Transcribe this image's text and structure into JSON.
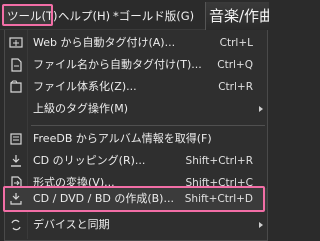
{
  "menubar": {
    "tools_label": "ツール(T)",
    "help_label": "ヘルプ(H)",
    "gold_label": "*ゴールド版(G)",
    "right_title": "音楽/作曲"
  },
  "menu": {
    "items": [
      {
        "label": "Web から自動タグ付け(A)...",
        "shortcut": "Ctrl+L",
        "icon": "web-tag-icon"
      },
      {
        "label": "ファイル名から自動タグ付け(T)...",
        "shortcut": "Ctrl+Q",
        "icon": "file-tag-icon"
      },
      {
        "label": "ファイル体系化(Z)...",
        "shortcut": "Ctrl+R",
        "icon": "organize-icon"
      },
      {
        "label": "上級のタグ操作(M)",
        "shortcut": "",
        "icon": "",
        "submenu": true
      },
      {
        "label": "FreeDB からアルバム情報を取得(F)",
        "shortcut": "",
        "icon": "freedb-icon"
      },
      {
        "label": "CD のリッピング(R)...",
        "shortcut": "Shift+Ctrl+R",
        "icon": "rip-cd-icon"
      },
      {
        "label": "形式の変換(V)...",
        "shortcut": "Shift+Ctrl+C",
        "icon": "convert-icon"
      },
      {
        "label": "CD / DVD / BD の作成(B)...",
        "shortcut": "Shift+Ctrl+D",
        "icon": "burn-disc-icon"
      },
      {
        "label": "デバイスと同期",
        "shortcut": "",
        "icon": "sync-icon",
        "submenu": true
      }
    ]
  },
  "colors": {
    "accent_highlight": "#f26ea6",
    "menu_bg": "#2f2f2f",
    "menubar_bg": "#2b2b2b"
  }
}
